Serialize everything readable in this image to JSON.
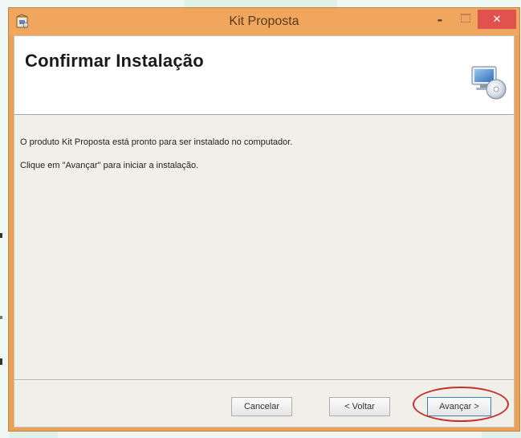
{
  "window": {
    "title": "Kit Proposta",
    "minimize_glyph": "-",
    "close_glyph": "✕",
    "app_icon": "installer-package-icon"
  },
  "header": {
    "heading": "Confirmar Instalação",
    "icon": "computer-disc-setup-icon"
  },
  "body": {
    "line1": "O produto Kit Proposta está pronto para ser instalado no computador.",
    "line2": "Clique em \"Avançar\" para iniciar a instalação."
  },
  "buttons": {
    "cancel": "Cancelar",
    "back": "< Voltar",
    "next": "Avançar >"
  },
  "colors": {
    "titlebar": "#f0a65d",
    "close": "#e0524e",
    "highlight_ellipse": "#c4312c"
  }
}
